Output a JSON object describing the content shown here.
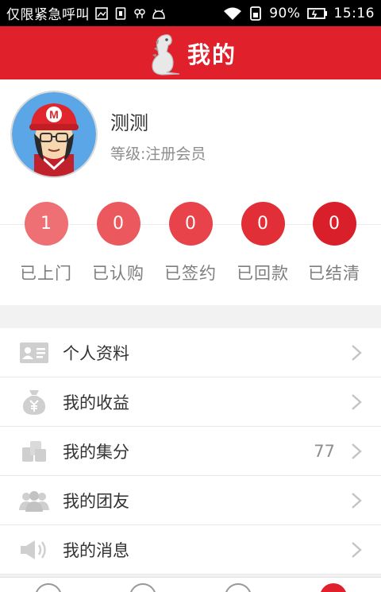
{
  "status_bar": {
    "carrier": "仅限紧急呼叫",
    "battery": "90%",
    "time": "15:16"
  },
  "header": {
    "title": "我的"
  },
  "profile": {
    "name": "测测",
    "level": "等级:注册会员"
  },
  "stats": [
    {
      "count": "1",
      "label": "已上门",
      "color": "#ee6f74"
    },
    {
      "count": "0",
      "label": "已认购",
      "color": "#eb585e"
    },
    {
      "count": "0",
      "label": "已签约",
      "color": "#e8434a"
    },
    {
      "count": "0",
      "label": "已回款",
      "color": "#e22f37"
    },
    {
      "count": "0",
      "label": "已结清",
      "color": "#d91f29"
    }
  ],
  "menu": [
    {
      "label": "个人资料",
      "icon": "id-card-icon",
      "value": ""
    },
    {
      "label": "我的收益",
      "icon": "money-bag-icon",
      "value": ""
    },
    {
      "label": "我的集分",
      "icon": "coins-icon",
      "value": "77"
    },
    {
      "label": "我的团友",
      "icon": "group-icon",
      "value": ""
    },
    {
      "label": "我的消息",
      "icon": "speaker-icon",
      "value": ""
    }
  ],
  "colors": {
    "brand_red": "#e0202a",
    "icon_gray": "#c8c8c8"
  }
}
